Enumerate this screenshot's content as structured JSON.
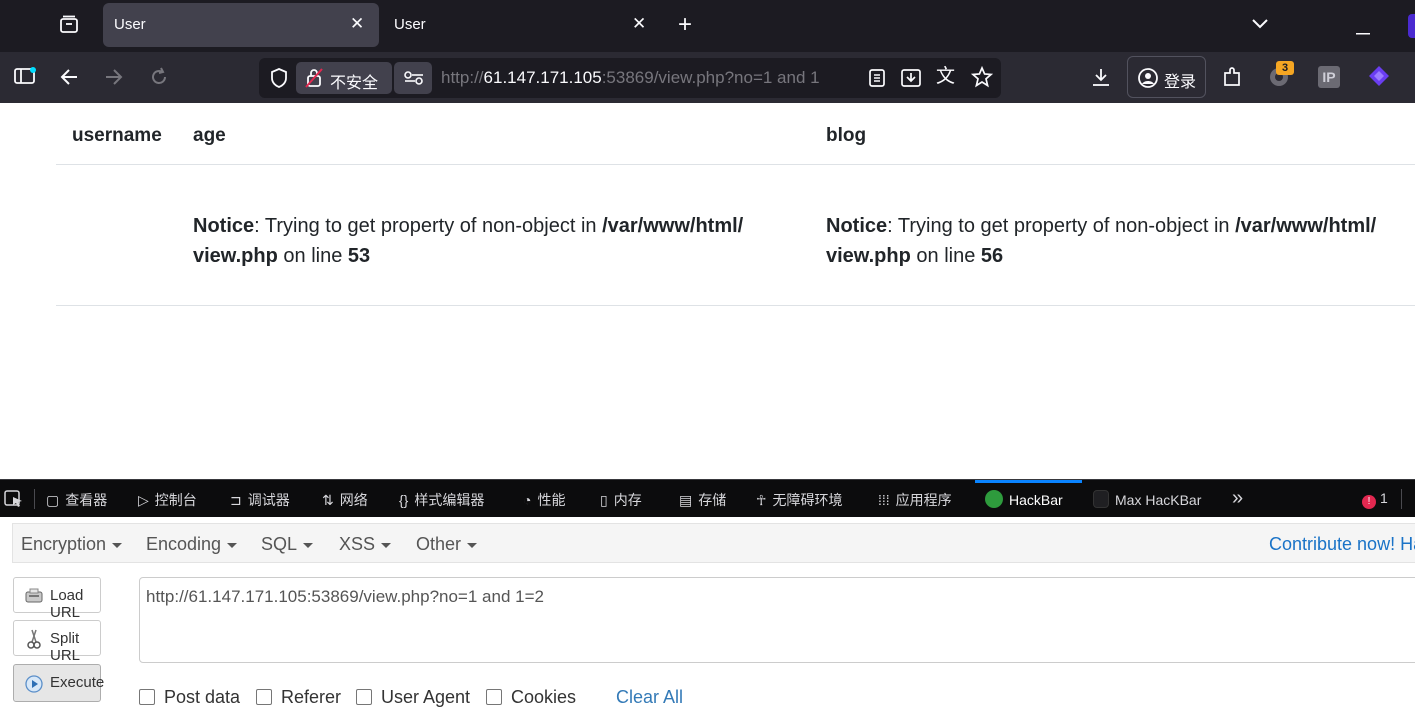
{
  "browser": {
    "tabs": [
      {
        "title": "User",
        "active": true
      },
      {
        "title": "User",
        "active": false
      }
    ],
    "new_tab": "+",
    "security_label": "不安全",
    "url": {
      "scheme": "http://",
      "host": "61.147.171.105",
      "rest": ":53869/view.php?no=1 and 1"
    },
    "login_label": "登录",
    "extension_badge": "3",
    "ip_extension": "IP"
  },
  "page": {
    "headers": [
      "username",
      "age",
      "blog"
    ],
    "notices": [
      {
        "label": "Notice",
        "text": ": Trying to get property of non-object in ",
        "path": "/var/www/html/",
        "file": "view.php",
        "on_line": " on line ",
        "line": "53"
      },
      {
        "label": "Notice",
        "text": ": Trying to get property of non-object in ",
        "path": "/var/www/html/",
        "file": "view.php",
        "on_line": " on line ",
        "line": "56"
      }
    ]
  },
  "devtools": {
    "tabs": [
      "查看器",
      "控制台",
      "调试器",
      "网络",
      "样式编辑器",
      "性能",
      "内存",
      "存储",
      "无障碍环境",
      "应用程序",
      "HackBar",
      "Max HacKBar"
    ],
    "active_tab": "HackBar",
    "error_count": "1"
  },
  "hackbar": {
    "menus": [
      "Encryption",
      "Encoding",
      "SQL",
      "XSS",
      "Other"
    ],
    "contribute": "Contribute now!",
    "contribute_tail": "Ha",
    "buttons": [
      "Load URL",
      "Split URL",
      "Execute"
    ],
    "url_value": "http://61.147.171.105:53869/view.php?no=1 and 1=2",
    "checkboxes": [
      "Post data",
      "Referer",
      "User Agent",
      "Cookies"
    ],
    "clear_all": "Clear All"
  },
  "colors": {
    "tabbar_bg": "#1c1b22",
    "navbar_bg": "#2b2a33",
    "hackbar_accent": "#1a73c7",
    "link_blue": "#337ab7",
    "error_red": "#e22850"
  }
}
